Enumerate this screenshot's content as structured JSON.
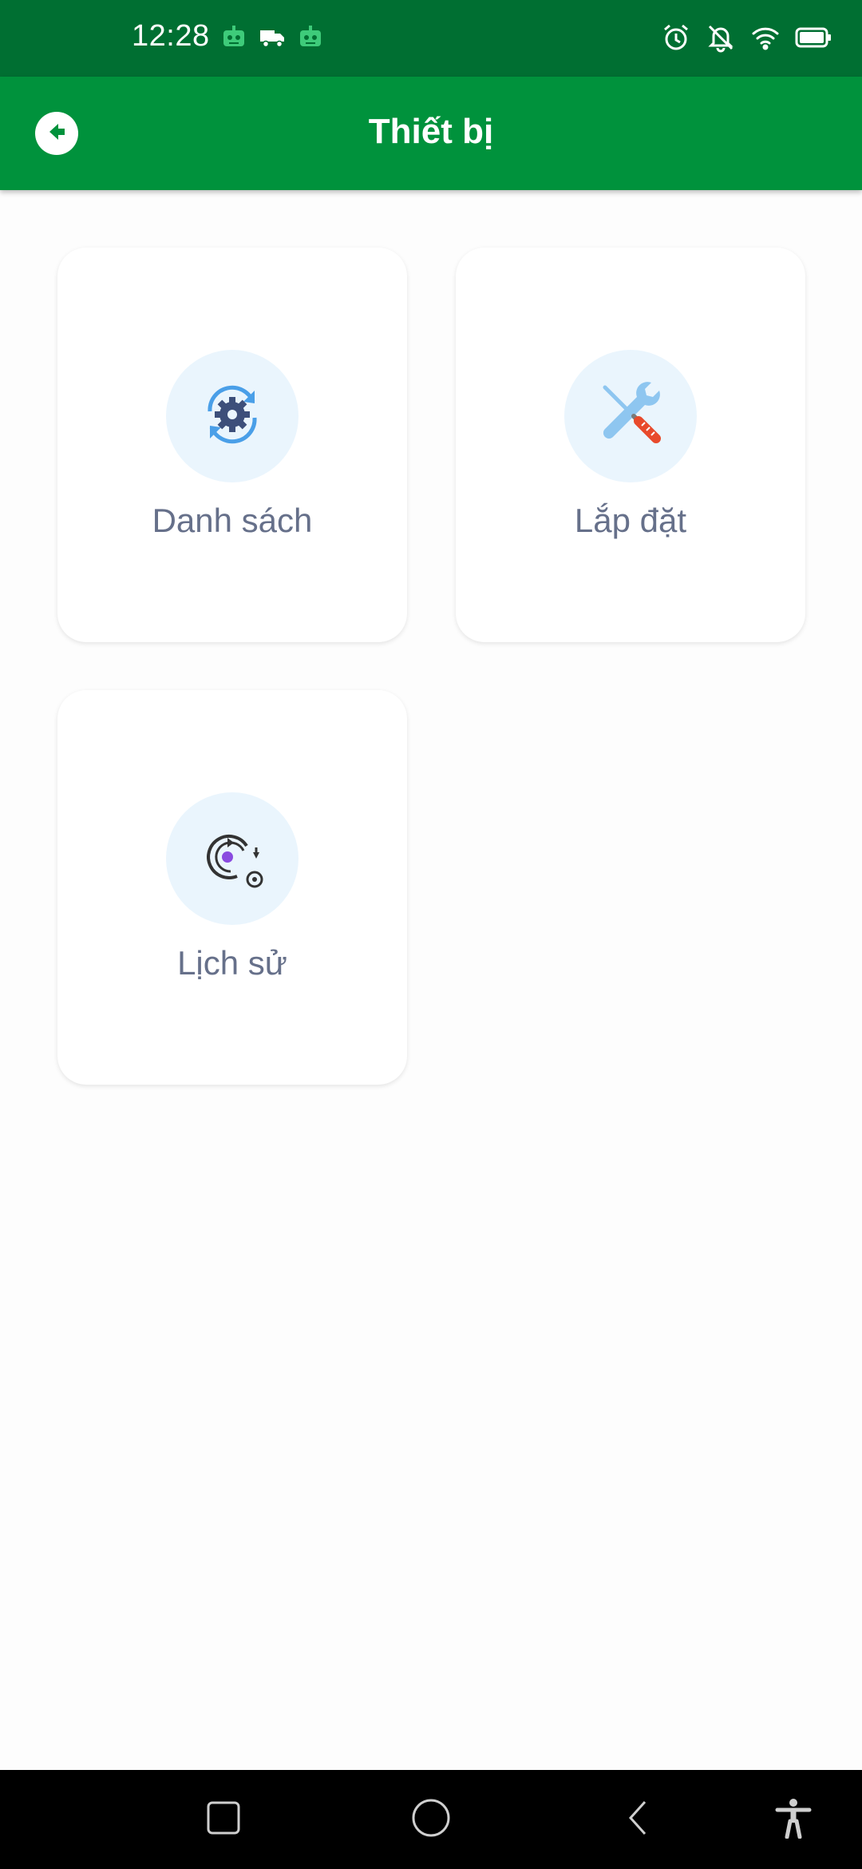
{
  "status_bar": {
    "time": "12:28",
    "left_icons": [
      "android-robot-icon",
      "truck-icon",
      "android-robot-icon"
    ],
    "right_icons": [
      "alarm-icon",
      "bell-off-icon",
      "wifi-icon",
      "battery-icon"
    ]
  },
  "app_bar": {
    "title": "Thiết bị",
    "back_icon": "arrow-left-circle-icon"
  },
  "tiles": [
    {
      "label": "Danh sách",
      "icon": "gear-refresh-icon"
    },
    {
      "label": "Lắp đặt",
      "icon": "wrench-screwdriver-icon"
    },
    {
      "label": "Lịch sử",
      "icon": "history-icon"
    }
  ],
  "colors": {
    "status_bar": "#006f32",
    "app_bar": "#00923c",
    "icon_circle": "#eaf5fd",
    "tile_label": "#66708a"
  },
  "nav_bar": {
    "buttons": [
      "recent-apps-icon",
      "home-icon",
      "back-icon",
      "accessibility-icon"
    ]
  }
}
